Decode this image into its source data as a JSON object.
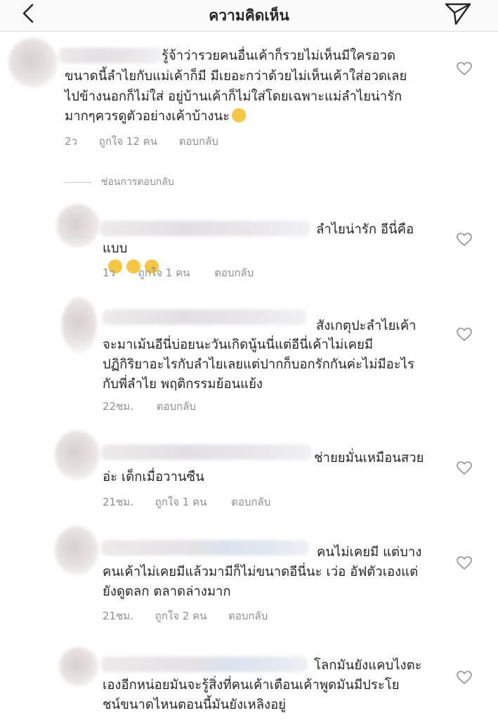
{
  "header": {
    "title": "ความคิดเห็น",
    "back_icon": "chevron-left-icon",
    "send_icon": "paper-plane-icon"
  },
  "hidden_replies_label": "ซ่อนการตอบกลับ",
  "comments": [
    {
      "text_lines": [
        "รู้จ้าว่ารวยคนอื่นเค้าก็รวยไม่เห็นมีใครอวด",
        "ขนาดนี้ลำไยกับแม่เค้าก็มี มีเยอะกว่าด้วยไม่เห็นเค้าใส่อวดเลย",
        "ไปข้างนอกก็ไม่ใส่ อยู่บ้านเค้าก็ไม่ใส่โดยเฉพาะแม่ลำไยน่ารัก",
        "มากๆควรดูตัวอย่างเค้าบ้างนะ"
      ],
      "emoji": "😌",
      "time": "2ว",
      "likes": "ถูกใจ 12 คน",
      "reply": "ตอบกลับ"
    },
    {
      "text_lines": [
        "ลำไยน่ารัก อีนี่คือ",
        "แบบ"
      ],
      "emoji": "🙄🙄🙄",
      "time": "1ว",
      "likes": "ถูกใจ 1 คน",
      "reply": "ตอบกลับ"
    },
    {
      "text_lines": [
        "สังเกตุปะลำไยเค้า",
        "จะมาเม้นอีนี่บ่อยนะวันเกิดนู้นนี่แต่อีนี่เค้าไม่เคยมี",
        "ปฏิกิริยาอะไรกับลำไยเลยแต่ปากก็บอกรักกันค่ะไม่มีอะไร",
        "กับพี่ลำไย พฤติกรรมย้อนแย้ง"
      ],
      "time": "22ชม.",
      "reply": "ตอบกลับ"
    },
    {
      "text_lines": [
        "ช่ายยมั่นเหมือนสวย",
        "อ่ะ เด็กเมื่อวานซืน"
      ],
      "time": "21ชม.",
      "likes": "ถูกใจ 1 คน",
      "reply": "ตอบกลับ"
    },
    {
      "text_lines": [
        "คนไม่เคยมี แต่บาง",
        "คนเค้าไม่เคยมีแล้วมามีก็ไม่ขนาดอีนี่นะ เว่อ อัฟตัวเองแต่",
        "ยังดูตลก ตลาดล่างมาก"
      ],
      "time": "21ชม.",
      "likes": "ถูกใจ 2 คน",
      "reply": "ตอบกลับ"
    },
    {
      "text_lines": [
        "โลกมันยังแคบไงตะ",
        "เองอีกหน่อยมันจะรู้สิ่งที่คนเค้าเตือนเค้าพูดมันมีประโย",
        "ชน์ขนาดไหนตอนนี้มันยังเหลิงอยู่"
      ]
    }
  ]
}
